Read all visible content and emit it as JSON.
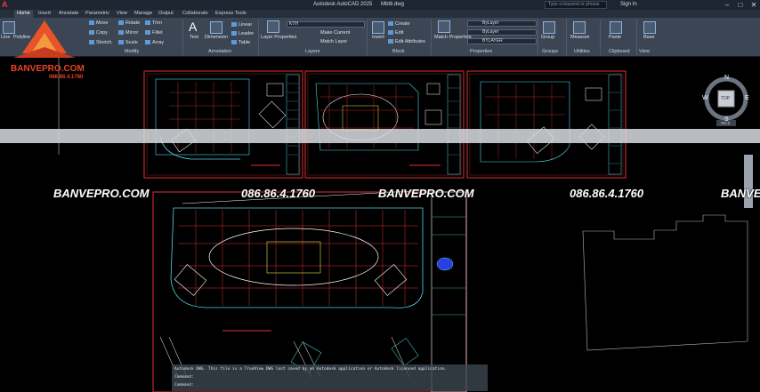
{
  "titlebar": {
    "doc_title": "Autodesk AutoCAD 2025",
    "file_name": "Mbt6.dwg",
    "search_placeholder": "Type a keyword or phrase",
    "signin": "Sign In",
    "min": "–",
    "max": "□",
    "close": "✕",
    "app_icon": "A"
  },
  "tabs": [
    {
      "label": "Home"
    },
    {
      "label": "Insert"
    },
    {
      "label": "Annotate"
    },
    {
      "label": "Parametric"
    },
    {
      "label": "View"
    },
    {
      "label": "Manage"
    },
    {
      "label": "Output"
    },
    {
      "label": "Collaborate"
    },
    {
      "label": "Express Tools"
    }
  ],
  "ribbon": {
    "draw": {
      "line": "Line",
      "polyline": "Polyline"
    },
    "modify": {
      "title": "Modify",
      "move": "Move",
      "rotate": "Rotate",
      "trim": "Trim",
      "copy": "Copy",
      "mirror": "Mirror",
      "fillet": "Fillet",
      "stretch": "Stretch",
      "scale": "Scale",
      "array": "Array"
    },
    "annotation": {
      "title": "Annotation",
      "text": "Text",
      "dimension": "Dimension",
      "linear": "Linear",
      "leader": "Leader",
      "table": "Table"
    },
    "layers": {
      "title": "Layers",
      "layer_properties": "Layer Properties",
      "current_layer": "KTH",
      "make_current": "Make Current",
      "match_layer": "Match Layer",
      "ribbon_layer": "KTH"
    },
    "block": {
      "title": "Block",
      "insert": "Insert",
      "create": "Create",
      "edit": "Edit",
      "edit_attributes": "Edit Attributes"
    },
    "properties": {
      "title": "Properties",
      "match": "Match Properties",
      "bylayer1": "ByLayer",
      "bylayer2": "ByLayer",
      "bylayer3": "BYLAYER"
    },
    "groups": {
      "title": "Groups",
      "group": "Group"
    },
    "utilities": {
      "title": "Utilities",
      "measure": "Measure"
    },
    "clipboard": {
      "title": "Clipboard",
      "paste": "Paste"
    },
    "view": {
      "title": "View",
      "base": "Base"
    }
  },
  "viewcube": {
    "n": "N",
    "s": "S",
    "e": "E",
    "w": "W",
    "top": "TOP",
    "wcs": "WCS"
  },
  "watermark": {
    "brand": "BANVEPRO.COM",
    "phone": "086.86.4.1760"
  },
  "logo": {
    "name": "BANVEPRO.COM",
    "phone": "086.86.4.1760"
  },
  "command": {
    "line1": "Autodesk DWG. This file is a TrueView DWG last saved by an Autodesk application or Autodesk licensed application.",
    "line2": "Command:",
    "line3": "Command:"
  },
  "colors": {
    "accent": "#e23a3a",
    "ribbon": "#3b4554",
    "drawing_red": "#e03030",
    "drawing_cyan": "#4fd7e8",
    "drawing_white": "#ffffff",
    "drawing_yellow": "#e6e64a"
  }
}
